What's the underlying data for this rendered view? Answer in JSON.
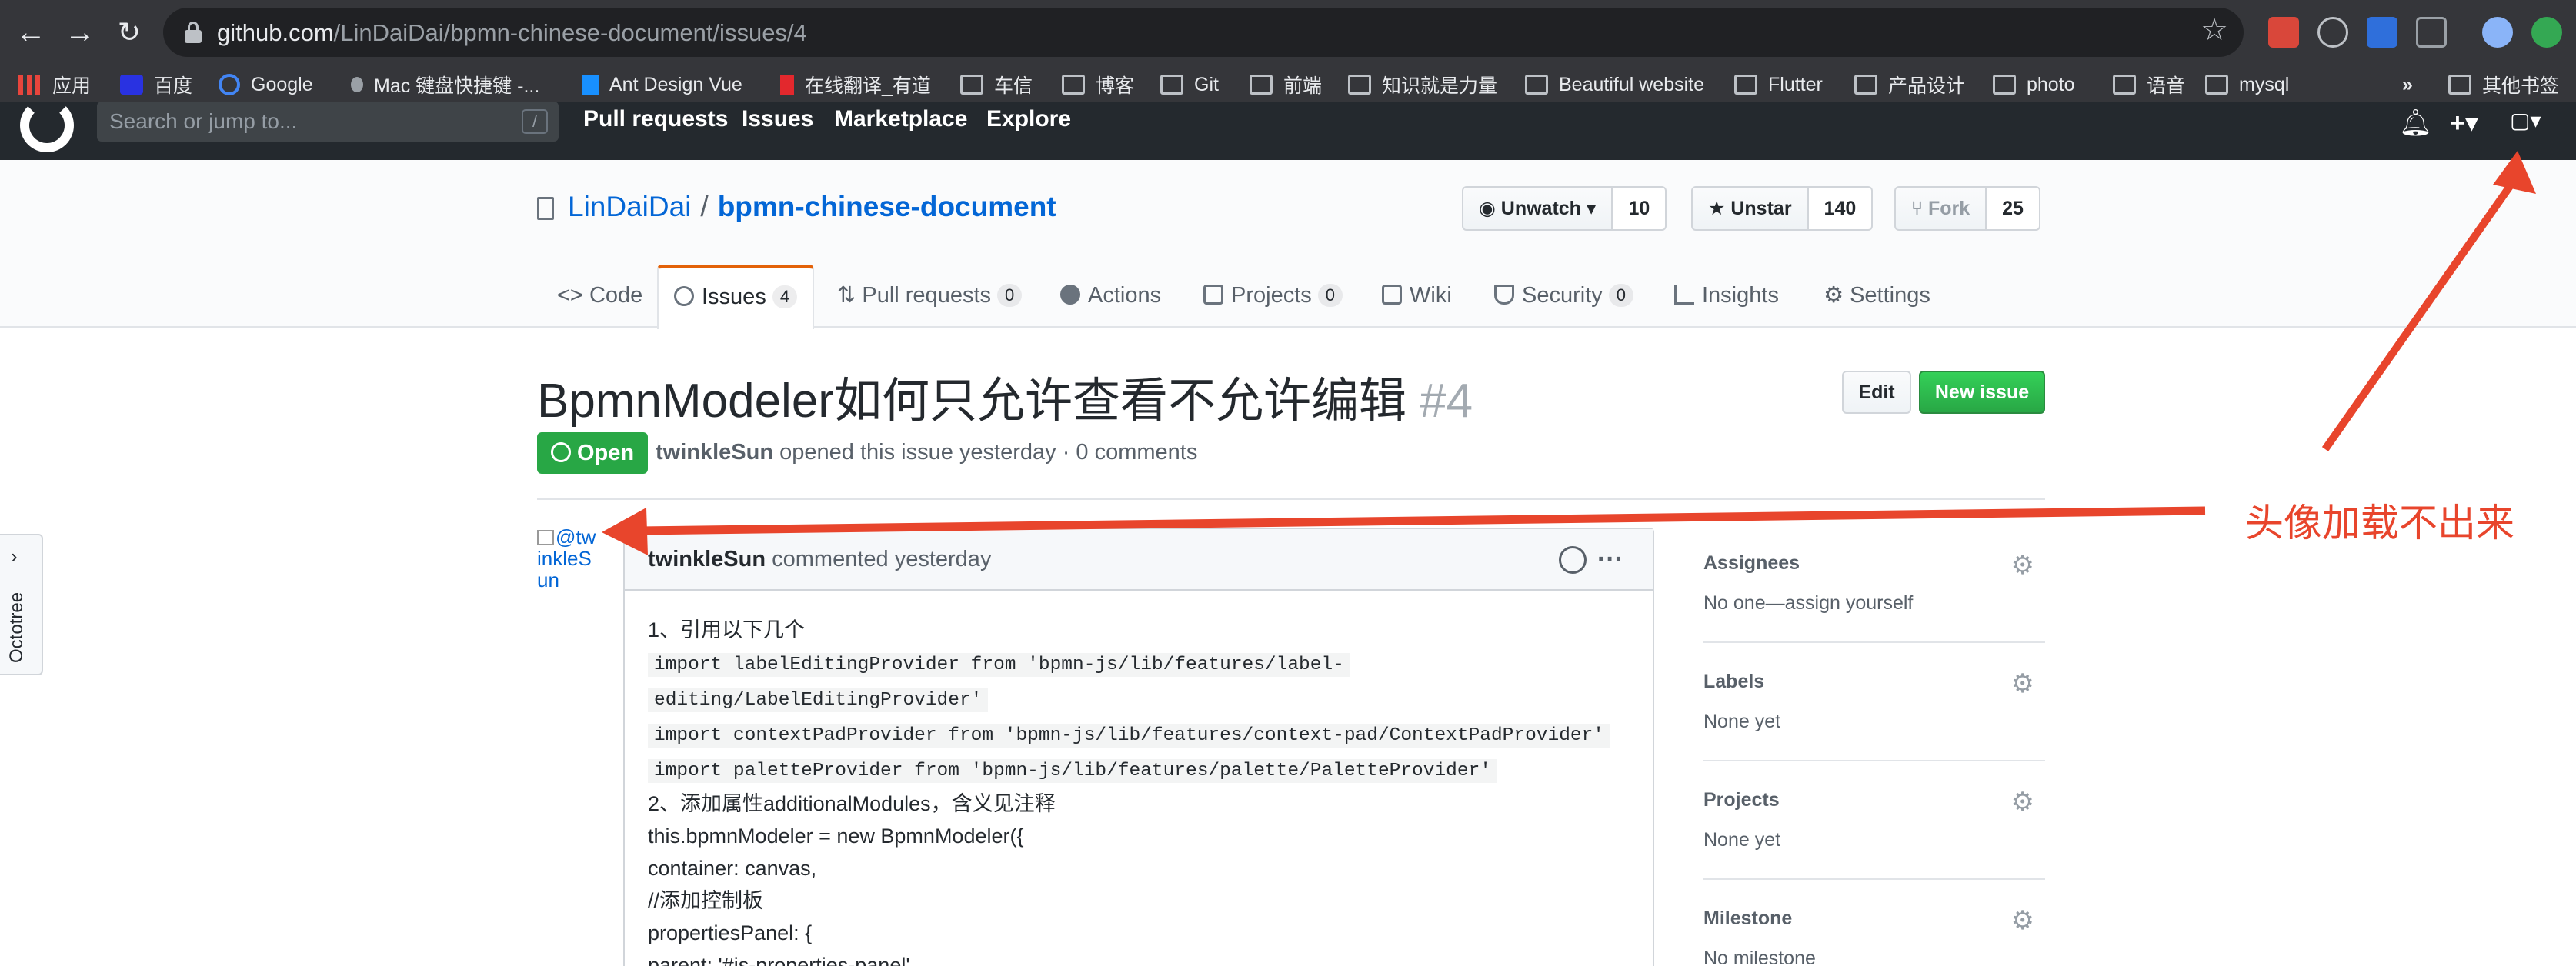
{
  "browser": {
    "url_host": "github.com",
    "url_path": "/LinDaiDai/bpmn-chinese-document/issues/4",
    "bookmarks": [
      "应用",
      "百度",
      "Google",
      "Mac 键盘快捷键 -...",
      "Ant Design Vue",
      "在线翻译_有道",
      "车信",
      "博客",
      "Git",
      "前端",
      "知识就是力量",
      "Beautiful website",
      "Flutter",
      "产品设计",
      "photo",
      "语音",
      "mysql"
    ],
    "more_bookmarks": "»",
    "other_bookmarks": "其他书签"
  },
  "gh_header": {
    "search_placeholder": "Search or jump to...",
    "search_hotkey": "/",
    "nav": [
      "Pull requests",
      "Issues",
      "Marketplace",
      "Explore"
    ]
  },
  "repo": {
    "owner": "LinDaiDai",
    "separator": "/",
    "name": "bpmn-chinese-document",
    "watch_label": "Unwatch ▾",
    "watch_count": "10",
    "star_label": "Unstar",
    "star_count": "140",
    "fork_label": "Fork",
    "fork_count": "25",
    "tabs": [
      {
        "label": "Code",
        "count": null
      },
      {
        "label": "Issues",
        "count": "4"
      },
      {
        "label": "Pull requests",
        "count": "0"
      },
      {
        "label": "Actions",
        "count": null
      },
      {
        "label": "Projects",
        "count": "0"
      },
      {
        "label": "Wiki",
        "count": null
      },
      {
        "label": "Security",
        "count": "0"
      },
      {
        "label": "Insights",
        "count": null
      },
      {
        "label": "Settings",
        "count": null
      }
    ]
  },
  "issue": {
    "title": "BpmnModeler如何只允许查看不允许编辑",
    "number": "#4",
    "edit_label": "Edit",
    "new_issue_label": "New issue",
    "state": "Open",
    "author": "twinkleSun",
    "opened_text": "opened this issue yesterday · 0 comments",
    "avatar_alt": "@twinkleSun"
  },
  "comment": {
    "author": "twinkleSun",
    "meta": "commented yesterday",
    "more": "···",
    "lines": [
      "1、引用以下几个",
      "import labelEditingProvider from 'bpmn-js/lib/features/label-",
      "editing/LabelEditingProvider'",
      "import contextPadProvider from 'bpmn-js/lib/features/context-pad/ContextPadProvider'",
      "import paletteProvider from 'bpmn-js/lib/features/palette/PaletteProvider'",
      "2、添加属性additionalModules，含义见注释",
      "this.bpmnModeler = new BpmnModeler({",
      "container: canvas,",
      "//添加控制板",
      "propertiesPanel: {",
      "parent: '#js-properties-panel'"
    ]
  },
  "sidebar": [
    {
      "title": "Assignees",
      "value": "No one—assign yourself"
    },
    {
      "title": "Labels",
      "value": "None yet"
    },
    {
      "title": "Projects",
      "value": "None yet"
    },
    {
      "title": "Milestone",
      "value": "No milestone"
    }
  ],
  "octotree": {
    "label": "Octotree",
    "chevron": "›"
  },
  "annotation": {
    "text": "头像加载不出来",
    "color": "#e8452c"
  }
}
